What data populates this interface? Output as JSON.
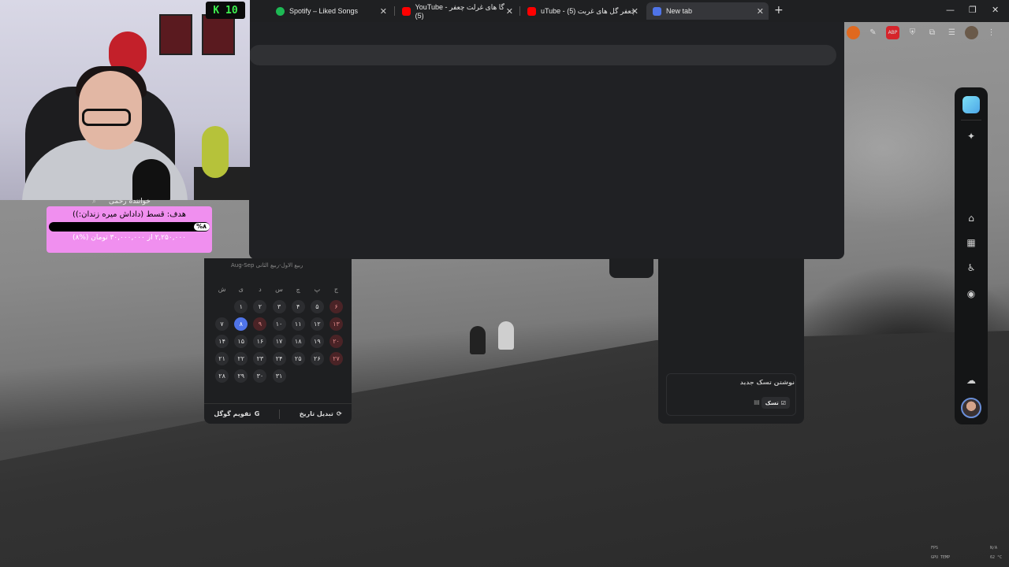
{
  "tabs": [
    {
      "label": "Spotify – Liked Songs",
      "icon": "spotify-icon",
      "color": "#1db954"
    },
    {
      "label": "YouTube - گا های غرلت چعفر (5)",
      "icon": "youtube-icon",
      "color": "#ff0000"
    },
    {
      "label": "uTube - چعفر گل های غربت (5)",
      "icon": "youtube-icon",
      "color": "#ff0000"
    },
    {
      "label": "New tab",
      "icon": "newtab-icon",
      "color": "#4f74e8"
    }
  ],
  "window": {
    "minimize": "—",
    "maximize": "❐",
    "close": "✕",
    "new_tab": "+"
  },
  "overlay": {
    "k_badge": "K 10",
    "reader_label": "خواننده رحمی",
    "goal_title": "هدف: قسط (داداش میره زندان:))",
    "goal_percent": "%۸",
    "goal_fraction": 0.08,
    "goal_amount": "۲,۲۵۰,۰۰۰ از ۳۰,۰۰۰,۰۰۰ تومان (%۸)"
  },
  "calendar": {
    "month_label": "ربیع الاول-ربیع الثانی  Aug-Sep",
    "weekdays": [
      "ش",
      "ی",
      "د",
      "س",
      "چ",
      "پ",
      "ج"
    ],
    "weeks": [
      [
        "",
        "۱",
        "۲",
        "۳",
        "۴",
        "۵",
        "۶"
      ],
      [
        "۷",
        "۸",
        "۹",
        "۱۰",
        "۱۱",
        "۱۲",
        "۱۳"
      ],
      [
        "۱۴",
        "۱۵",
        "۱۶",
        "۱۷",
        "۱۸",
        "۱۹",
        "۲۰"
      ],
      [
        "۲۱",
        "۲۲",
        "۲۳",
        "۲۴",
        "۲۵",
        "۲۶",
        "۲۷"
      ],
      [
        "۲۸",
        "۲۹",
        "۳۰",
        "۳۱",
        "",
        "",
        ""
      ]
    ],
    "today": "۸",
    "holidays": [
      "۶",
      "۹",
      "۱۳",
      "۲۰",
      "۲۷"
    ],
    "footer_google": "تقویم گوگل",
    "footer_convert": "تبدیل تاریخ"
  },
  "tasks": {
    "new_task_label": "نوشتن تسک جدید",
    "chip_label": "تسک"
  },
  "stats": {
    "fps_label": "FPS",
    "fps_value": "N/A",
    "gpu_label": "GPU TEMP",
    "gpu_value": "62 °C"
  }
}
